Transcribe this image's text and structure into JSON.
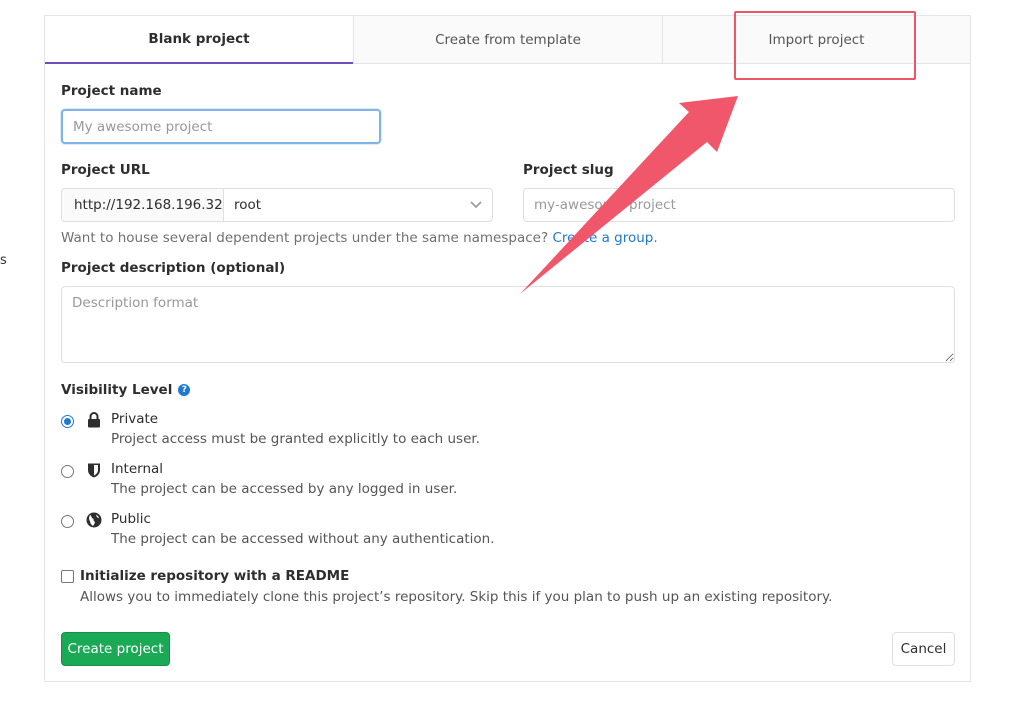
{
  "side_fragment": "s",
  "tabs": [
    {
      "label": "Blank project",
      "active": true
    },
    {
      "label": "Create from template",
      "active": false
    },
    {
      "label": "Import project",
      "active": false
    }
  ],
  "form": {
    "project_name": {
      "label": "Project name",
      "placeholder": "My awesome project",
      "value": ""
    },
    "project_url": {
      "label": "Project URL",
      "prefix": "http://192.168.196.32/",
      "namespace": "root"
    },
    "project_slug": {
      "label": "Project slug",
      "placeholder": "my-awesome-project"
    },
    "namespace_help": {
      "text": "Want to house several dependent projects under the same namespace?",
      "link": "Create a group."
    },
    "description": {
      "label": "Project description (optional)",
      "placeholder": "Description format"
    },
    "visibility": {
      "label": "Visibility Level",
      "options": [
        {
          "title": "Private",
          "desc": "Project access must be granted explicitly to each user.",
          "icon": "lock-icon",
          "checked": true
        },
        {
          "title": "Internal",
          "desc": "The project can be accessed by any logged in user.",
          "icon": "shield-icon",
          "checked": false
        },
        {
          "title": "Public",
          "desc": "The project can be accessed without any authentication.",
          "icon": "globe-icon",
          "checked": false
        }
      ]
    },
    "readme": {
      "title": "Initialize repository with a README",
      "desc": "Allows you to immediately clone this project’s repository. Skip this if you plan to push up an existing repository.",
      "checked": false
    }
  },
  "buttons": {
    "create": "Create project",
    "cancel": "Cancel"
  },
  "colors": {
    "accent": "#1f78d1",
    "primary_button": "#1aaa55",
    "tab_underline": "#6b4fbb",
    "annotation": "#ee5566"
  }
}
